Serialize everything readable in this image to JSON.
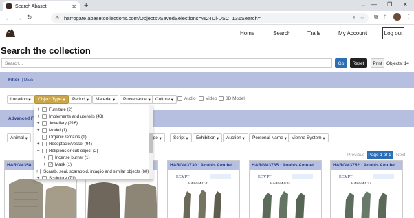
{
  "browser": {
    "tab_title": "Search Abaset",
    "url": "harrogate.abasetcollections.com/Objects?SavedSelections=%24Di-DSC_13&Search="
  },
  "nav": {
    "links": [
      "Home",
      "Search",
      "Trails",
      "My Account"
    ],
    "logout": "Log out"
  },
  "page": {
    "title": "Search the collection",
    "search_placeholder": "Search...",
    "go": "Go",
    "reset": "Reset",
    "print": "Print",
    "objects_count": "Objects: 14"
  },
  "filter": {
    "label": "Filter",
    "mask": "| Mask",
    "chips": [
      "Location",
      "Object Type",
      "Period",
      "Material",
      "Provenance",
      "Culture"
    ],
    "checkboxes": [
      "Audio",
      "Video",
      "3D Model"
    ]
  },
  "advanced": {
    "label": "Advanced Fi",
    "chips": [
      "Animal",
      "age",
      "Script",
      "Exhibition",
      "Auction",
      "Personal Name",
      "Vienna System"
    ]
  },
  "pagination": {
    "prev": "Previous",
    "current": "Page 1 of 1",
    "next": "Next"
  },
  "cards": [
    {
      "title": "HARGM358"
    },
    {
      "title": ""
    },
    {
      "title": "HARGM3730 : Anubis Amulet"
    },
    {
      "title": "HARGM3735 : Anubis Amulet"
    },
    {
      "title": "HARGM3752 : Anubis Amulet"
    }
  ],
  "card_image_text": [
    "EGYPT",
    "HARGM3730",
    "HARGM3735",
    "HARGM3752"
  ],
  "dropdown": {
    "items": [
      {
        "label": "Furniture (2)",
        "indent": 0,
        "expand": "+",
        "checked": false
      },
      {
        "label": "Implements and utensils (48)",
        "indent": 0,
        "expand": "+",
        "checked": false
      },
      {
        "label": "Jewellery (216)",
        "indent": 0,
        "expand": "+",
        "checked": false
      },
      {
        "label": "Model (1)",
        "indent": 0,
        "expand": "+",
        "checked": false
      },
      {
        "label": "Organic remains (1)",
        "indent": 0,
        "expand": "",
        "checked": false
      },
      {
        "label": "Receptacle/vessel (94)",
        "indent": 0,
        "expand": "+",
        "checked": false
      },
      {
        "label": "Religious or cult object (2)",
        "indent": 0,
        "expand": "−",
        "checked": false
      },
      {
        "label": "Incense burner (1)",
        "indent": 1,
        "expand": "+",
        "checked": false
      },
      {
        "label": "Mask (1)",
        "indent": 1,
        "expand": "+",
        "checked": true
      },
      {
        "label": "Scarab, seal, scaraboid, intaglio and similar objects (60)",
        "indent": 0,
        "expand": "+",
        "checked": false
      },
      {
        "label": "Sculpture (71)",
        "indent": 0,
        "expand": "+",
        "checked": false
      }
    ]
  }
}
